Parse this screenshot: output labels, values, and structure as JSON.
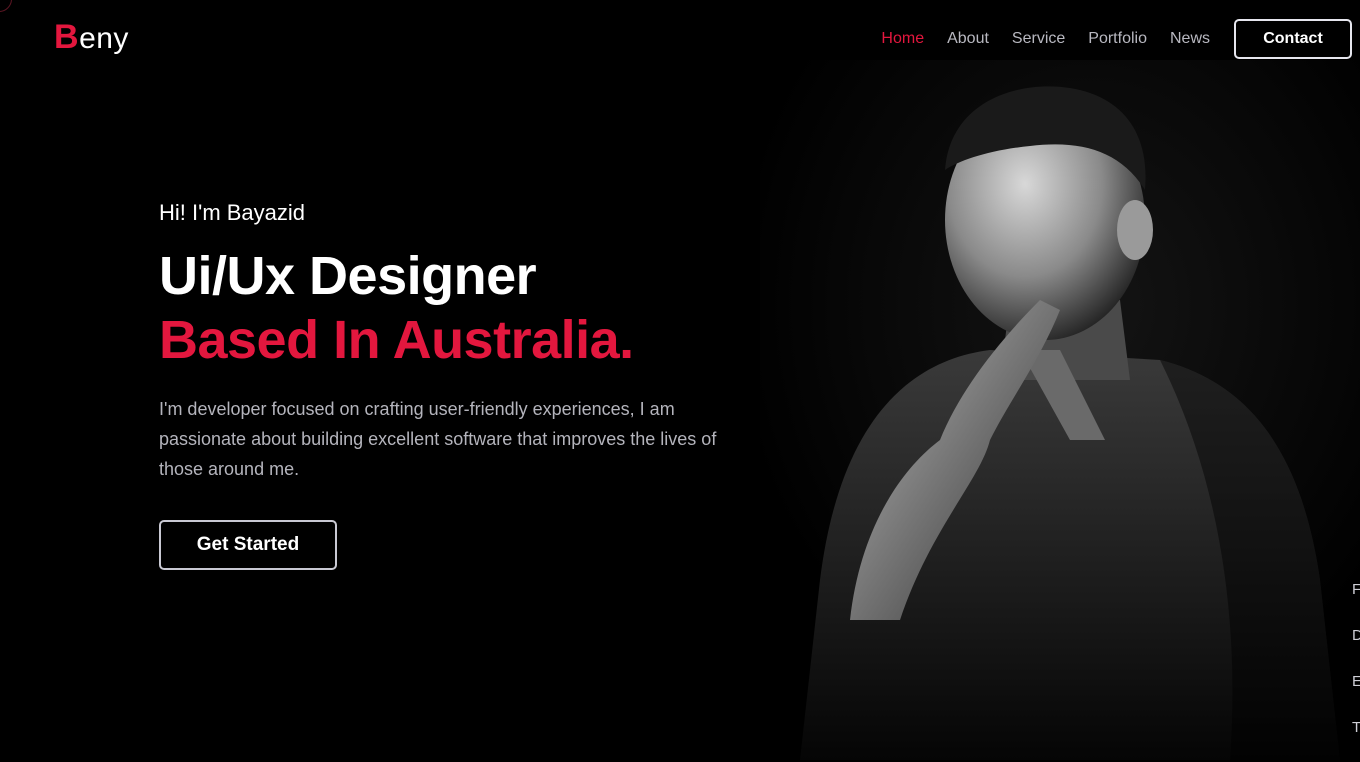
{
  "brand": {
    "initial": "B",
    "rest": "eny"
  },
  "nav": {
    "items": [
      {
        "label": "Home",
        "active": true
      },
      {
        "label": "About"
      },
      {
        "label": "Service"
      },
      {
        "label": "Portfolio"
      },
      {
        "label": "News"
      }
    ],
    "contact_label": "Contact"
  },
  "hero": {
    "greeting": "Hi! I'm Bayazid",
    "title_line1": "Ui/Ux Designer",
    "title_line2": "Based In Australia.",
    "description": "I'm developer focused on crafting user-friendly experiences, I am passionate about building excellent software that improves the lives of those around me.",
    "cta_label": "Get Started"
  },
  "side_letters": [
    "F",
    "D",
    "E",
    "T"
  ],
  "colors": {
    "accent": "#e3173e",
    "background": "#000000",
    "text": "#ffffff",
    "muted": "#b4b4bc"
  },
  "icons": [
    "portrait-photo"
  ]
}
